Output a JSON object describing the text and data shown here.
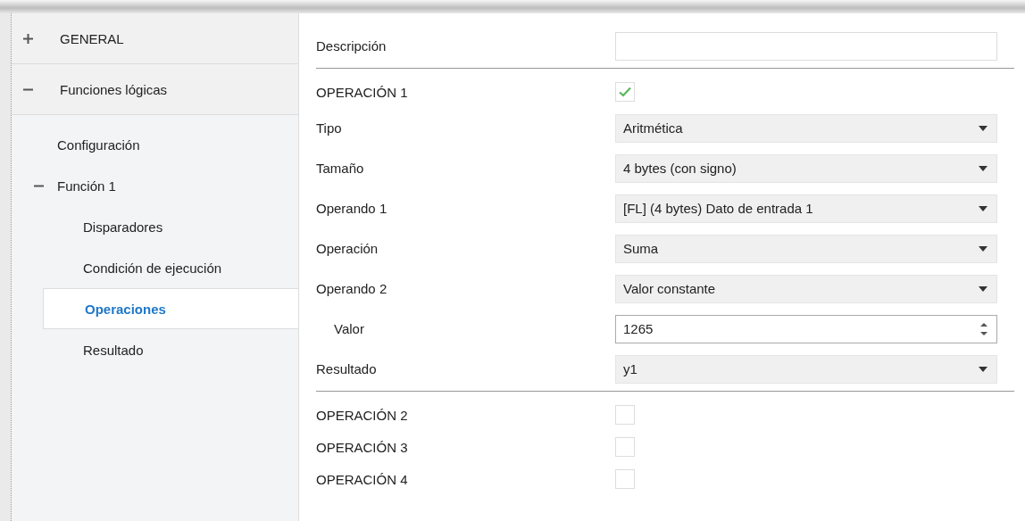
{
  "sidebar": {
    "items": [
      {
        "label": "GENERAL",
        "expanded": false,
        "selected": false
      },
      {
        "label": "Funciones lógicas",
        "expanded": true,
        "selected": false,
        "children": [
          {
            "label": "Configuración",
            "selected": false
          },
          {
            "label": "Función 1",
            "expanded": true,
            "selected": false,
            "children": [
              {
                "label": "Disparadores",
                "selected": false
              },
              {
                "label": "Condición de ejecución",
                "selected": false
              },
              {
                "label": "Operaciones",
                "selected": true
              },
              {
                "label": "Resultado",
                "selected": false
              }
            ]
          }
        ]
      }
    ]
  },
  "description": {
    "label": "Descripción"
  },
  "operations": [
    {
      "label": "OPERACIÓN 1",
      "checked": true,
      "fields": [
        {
          "kind": "select",
          "label": "Tipo",
          "value": "Aritmética"
        },
        {
          "kind": "select",
          "label": "Tamaño",
          "value": "4 bytes (con signo)"
        },
        {
          "kind": "select",
          "label": "Operando 1",
          "value": "[FL] (4 bytes) Dato de entrada 1"
        },
        {
          "kind": "select",
          "label": "Operación",
          "value": "Suma"
        },
        {
          "kind": "select",
          "label": "Operando 2",
          "value": "Valor constante",
          "children": [
            {
              "kind": "number",
              "label": "Valor",
              "value": "1265"
            }
          ]
        },
        {
          "kind": "select",
          "label": "Resultado",
          "value": "y1"
        }
      ]
    },
    {
      "label": "OPERACIÓN 2",
      "checked": false
    },
    {
      "label": "OPERACIÓN 3",
      "checked": false
    },
    {
      "label": "OPERACIÓN 4",
      "checked": false
    }
  ]
}
